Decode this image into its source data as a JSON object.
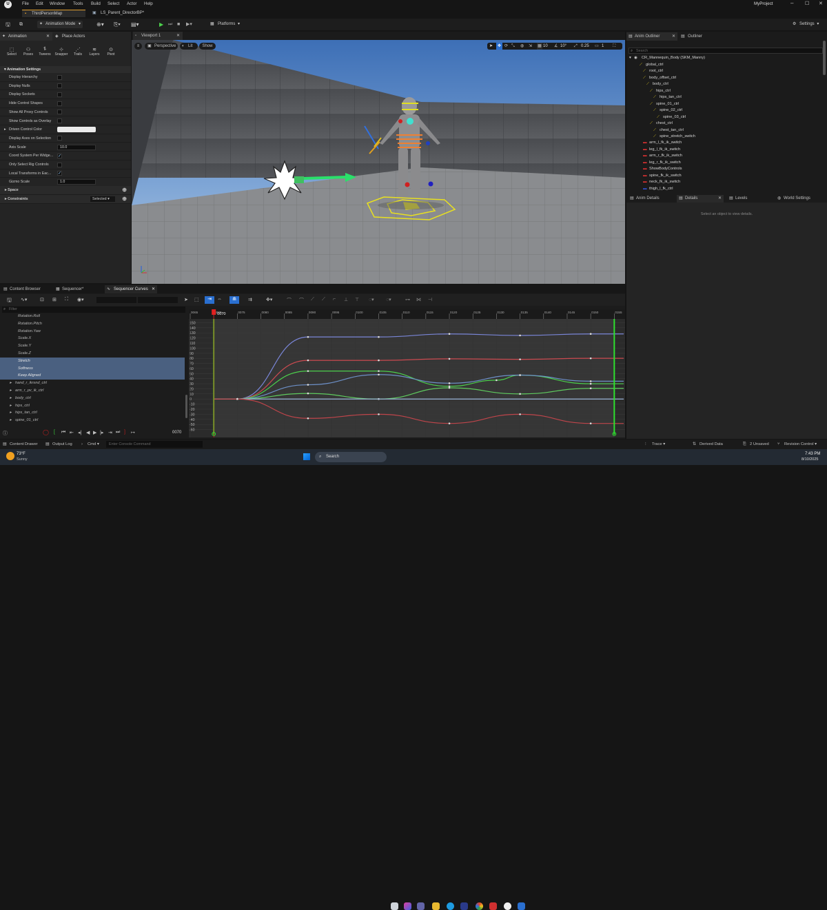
{
  "menubar": {
    "items": [
      "File",
      "Edit",
      "Window",
      "Tools",
      "Build",
      "Select",
      "Actor",
      "Help"
    ],
    "project": "MyProject"
  },
  "tabs": {
    "map": "ThirdPersonMap",
    "sequence": "LS_Parent_DirectorBP*"
  },
  "toolbar": {
    "mode": "Animation Mode",
    "platforms": "Platforms",
    "settings": "Settings"
  },
  "left_panel": {
    "tab_animation": "Animation",
    "tab_place": "Place Actors",
    "tools": [
      "Select",
      "Poses",
      "Tweens",
      "Snapper",
      "Trails",
      "Layers",
      "Pivot"
    ],
    "section": "Animation Settings",
    "properties": [
      {
        "label": "Display Hierarchy",
        "kind": "check",
        "on": false
      },
      {
        "label": "Display Nulls",
        "kind": "check",
        "on": false
      },
      {
        "label": "Display Sockets",
        "kind": "check",
        "on": false
      },
      {
        "label": "Hide Control Shapes",
        "kind": "check",
        "on": false
      },
      {
        "label": "Show All Proxy Controls",
        "kind": "check",
        "on": false
      },
      {
        "label": "Show Controls as Overlay",
        "kind": "check",
        "on": false
      },
      {
        "label": "Driven Control Color",
        "kind": "color",
        "value": ""
      },
      {
        "label": "Display Axes on Selection",
        "kind": "check",
        "on": false
      },
      {
        "label": "Axis Scale",
        "kind": "num",
        "value": "10.0"
      },
      {
        "label": "Coord System Per Widge...",
        "kind": "check",
        "on": true
      },
      {
        "label": "Only Select Rig Controls",
        "kind": "check",
        "on": false
      },
      {
        "label": "Local Transforms in Eac...",
        "kind": "check",
        "on": true
      },
      {
        "label": "Gizmo Scale",
        "kind": "num",
        "value": "1.0"
      }
    ],
    "space": "Space",
    "constraints": "Constraints",
    "selected": "Selected"
  },
  "viewport": {
    "tab": "Viewport 1",
    "perspective": "Perspective",
    "lit": "Lit",
    "show": "Show",
    "snap_grid": "10",
    "snap_rot": "10°",
    "snap_scale": "0.25",
    "cam_speed": "1"
  },
  "outliner": {
    "tab_anim": "Anim Outliner",
    "tab_outliner": "Outliner",
    "search_placeholder": "Search",
    "root": "CR_Mannequin_Body  (SKM_Manny)",
    "items": [
      {
        "label": "global_ctrl",
        "indent": 1,
        "kind": "ctrl"
      },
      {
        "label": "root_ctrl",
        "indent": 2,
        "kind": "ctrl"
      },
      {
        "label": "body_offset_ctrl",
        "indent": 2,
        "kind": "ctrl"
      },
      {
        "label": "body_ctrl",
        "indent": 3,
        "kind": "ctrl"
      },
      {
        "label": "hips_ctrl",
        "indent": 4,
        "kind": "ctrl"
      },
      {
        "label": "hips_tan_ctrl",
        "indent": 5,
        "kind": "ctrl"
      },
      {
        "label": "spine_01_ctrl",
        "indent": 4,
        "kind": "ctrl"
      },
      {
        "label": "spine_02_ctrl",
        "indent": 5,
        "kind": "ctrl"
      },
      {
        "label": "spine_03_ctrl",
        "indent": 6,
        "kind": "ctrl"
      },
      {
        "label": "chest_ctrl",
        "indent": 4,
        "kind": "ctrl"
      },
      {
        "label": "chest_tan_ctrl",
        "indent": 5,
        "kind": "ctrl"
      },
      {
        "label": "spine_stretch_switch",
        "indent": 5,
        "kind": "ctrl"
      },
      {
        "label": "arm_l_fk_ik_switch",
        "indent": 2,
        "kind": "switch"
      },
      {
        "label": "leg_l_fk_ik_switch",
        "indent": 2,
        "kind": "switch"
      },
      {
        "label": "arm_r_fk_ik_switch",
        "indent": 2,
        "kind": "switch"
      },
      {
        "label": "leg_r_fk_ik_switch",
        "indent": 2,
        "kind": "switch"
      },
      {
        "label": "ShowBodyControls",
        "indent": 2,
        "kind": "switch"
      },
      {
        "label": "spine_fk_ik_switch",
        "indent": 2,
        "kind": "switch"
      },
      {
        "label": "neck_fk_ik_switch",
        "indent": 2,
        "kind": "switch"
      },
      {
        "label": "thigh_l_fk_ctrl",
        "indent": 2,
        "kind": "blue"
      }
    ]
  },
  "details": {
    "tab_anim": "Anim Details",
    "tab_details": "Details",
    "tab_levels": "Levels",
    "tab_world": "World Settings",
    "empty": "Select an object to view details."
  },
  "bottom": {
    "tab_content": "Content Browser",
    "tab_seq": "Sequencer*",
    "tab_curves": "Sequencer Curves",
    "filter_placeholder": "Filter",
    "curve_names": [
      {
        "label": "Rotation.Roll",
        "sel": false
      },
      {
        "label": "Rotation.Pitch",
        "sel": false
      },
      {
        "label": "Rotation.Yaw",
        "sel": false
      },
      {
        "label": "Scale.X",
        "sel": false
      },
      {
        "label": "Scale.Y",
        "sel": false
      },
      {
        "label": "Scale.Z",
        "sel": false
      },
      {
        "label": "Stretch",
        "sel": true
      },
      {
        "label": "Softness",
        "sel": true
      },
      {
        "label": "Keep Aligned",
        "sel": true
      },
      {
        "label": "hand_r_ikrsnd_ctrl",
        "sel": false
      },
      {
        "label": "arm_r_pv_ik_ctrl",
        "sel": false
      },
      {
        "label": "body_ctrl",
        "sel": false
      },
      {
        "label": "hips_ctrl",
        "sel": false
      },
      {
        "label": "hips_tan_ctrl",
        "sel": false
      },
      {
        "label": "spine_01_ctrl",
        "sel": false
      }
    ],
    "frame": "0070",
    "current_frame": "0070",
    "timeline_ticks": [
      "0065",
      "0070",
      "0075",
      "0080",
      "0085",
      "0090",
      "0095",
      "0100",
      "0105",
      "0110",
      "0115",
      "0120",
      "0125",
      "0130",
      "0135",
      "0140",
      "0145",
      "0150",
      "0155"
    ],
    "y_ticks": [
      "150",
      "140",
      "130",
      "120",
      "110",
      "100",
      "90",
      "80",
      "70",
      "60",
      "50",
      "40",
      "30",
      "20",
      "10",
      "0",
      "-10",
      "-20",
      "-30",
      "-40",
      "-50",
      "-60"
    ]
  },
  "chart_data": {
    "type": "line",
    "xlabel": "",
    "ylabel": "",
    "xlim": [
      65,
      157
    ],
    "ylim": [
      -62,
      152
    ],
    "series": [
      {
        "color": "#7a86d8",
        "x": [
          70,
          75,
          90,
          105,
          120,
          135,
          150,
          157
        ],
        "values": [
          0,
          0,
          122,
          122,
          128,
          125,
          128,
          128
        ]
      },
      {
        "color": "#cc4a50",
        "x": [
          70,
          75,
          90,
          105,
          120,
          135,
          150,
          157
        ],
        "values": [
          0,
          0,
          76,
          76,
          79,
          78,
          80,
          80
        ]
      },
      {
        "color": "#4cd04c",
        "x": [
          70,
          75,
          90,
          105,
          120,
          130,
          135,
          150,
          157
        ],
        "values": [
          0,
          0,
          55,
          55,
          25,
          37,
          47,
          30,
          30
        ]
      },
      {
        "color": "#6d90c8",
        "x": [
          70,
          75,
          90,
          105,
          120,
          135,
          150,
          157
        ],
        "values": [
          0,
          0,
          28,
          48,
          31,
          47,
          35,
          35
        ]
      },
      {
        "color": "#5fcc5f",
        "x": [
          70,
          75,
          90,
          105,
          120,
          135,
          150,
          157
        ],
        "values": [
          0,
          0,
          11,
          0,
          22,
          10,
          21,
          21
        ]
      },
      {
        "color": "#9bb4d8",
        "x": [
          70,
          157
        ],
        "values": [
          0,
          0
        ]
      },
      {
        "color": "#c0454b",
        "x": [
          70,
          75,
          90,
          105,
          120,
          135,
          150,
          157
        ],
        "values": [
          0,
          0,
          -38,
          -30,
          -48,
          -30,
          -48,
          -48
        ]
      }
    ]
  },
  "statusbar": {
    "content_drawer": "Content Drawer",
    "output_log": "Output Log",
    "cmd": "Cmd",
    "console_placeholder": "Enter Console Command",
    "trace": "Trace",
    "derived": "Derived Data",
    "unsaved": "2 Unsaved",
    "revision": "Revision Control"
  },
  "taskbar": {
    "weather_temp": "73°F",
    "weather_desc": "Sunny",
    "search": "Search",
    "time": "7:43 PM",
    "date": "8/10/2025"
  }
}
